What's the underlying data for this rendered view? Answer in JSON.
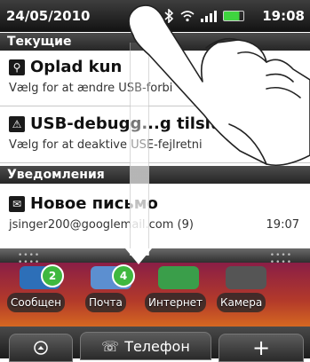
{
  "status_bar": {
    "date": "24/05/2010",
    "time": "19:08",
    "icons": [
      "bluetooth-icon",
      "wifi-icon",
      "signal-icon",
      "battery-icon"
    ]
  },
  "sections": {
    "current": "Текущие",
    "notifications": "Уведомления"
  },
  "current_items": [
    {
      "title": "Oplad kun",
      "subtitle": "Vælg for at ændre USB-forbi",
      "icon": "usb-icon"
    },
    {
      "title": "USB-debugg...g tilslu",
      "subtitle": "Vælg for at deaktive USE-fejlretni",
      "icon": "warning-icon"
    }
  ],
  "notification_items": [
    {
      "title": "Новое письмо",
      "subtitle": "jsinger200@googlemail.com (9)",
      "time": "19:07",
      "icon": "mail-icon"
    }
  ],
  "home": {
    "apps": [
      {
        "label": "Сообщен",
        "badge": "2"
      },
      {
        "label": "Почта",
        "badge": "4"
      },
      {
        "label": "Интернет"
      },
      {
        "label": "Камера"
      }
    ]
  },
  "dock": {
    "phone_label": "Телефон",
    "phone_icon": "☏",
    "add_label": "+"
  },
  "colors": {
    "status_bar": "#1b1b1b",
    "header": "#2f2f2f",
    "badge": "#3fb83f",
    "battery": "#3fd43f"
  }
}
